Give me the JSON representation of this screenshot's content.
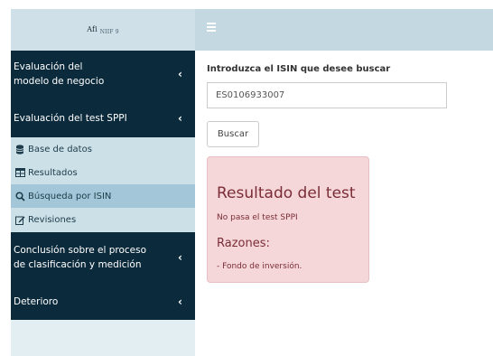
{
  "header": {
    "logo_main": "Afi",
    "logo_sub": "NIIF 9",
    "menu_icon": "hamburger-icon"
  },
  "sidebar": {
    "items": [
      {
        "label_line1": "Evaluación del",
        "label_line2": "modelo de negocio",
        "icon": "chevron-left-icon"
      },
      {
        "label": "Evaluación del test SPPI",
        "icon": "chevron-left-icon"
      },
      {
        "label_line1": "Conclusión sobre el proceso",
        "label_line2": "de clasificación y medición",
        "icon": "chevron-left-icon"
      },
      {
        "label": "Deterioro",
        "icon": "chevron-left-icon"
      }
    ],
    "subitems": [
      {
        "label": "Base de datos",
        "icon": "database-icon"
      },
      {
        "label": "Resultados",
        "icon": "table-icon"
      },
      {
        "label": "Búsqueda por ISIN",
        "icon": "search-icon",
        "active": true
      },
      {
        "label": "Revisiones",
        "icon": "edit-icon"
      }
    ]
  },
  "main": {
    "prompt_label": "Introduzca el ISIN que desee buscar",
    "isin_value": "ES0106933007",
    "search_button": "Buscar",
    "result": {
      "title": "Resultado del test",
      "status": "No pasa el test SPPI",
      "reasons_title": "Razones:",
      "reasons": [
        "- Fondo de inversión."
      ]
    }
  },
  "colors": {
    "sidebar_dark": "#0b2a3b",
    "sidebar_light": "#e2eef2",
    "submenu_bg": "#cce0e8",
    "submenu_active": "#a3c7d8",
    "topbar": "#c4d8e1",
    "result_bg": "#f5d6d9",
    "result_text": "#7a2d36"
  }
}
